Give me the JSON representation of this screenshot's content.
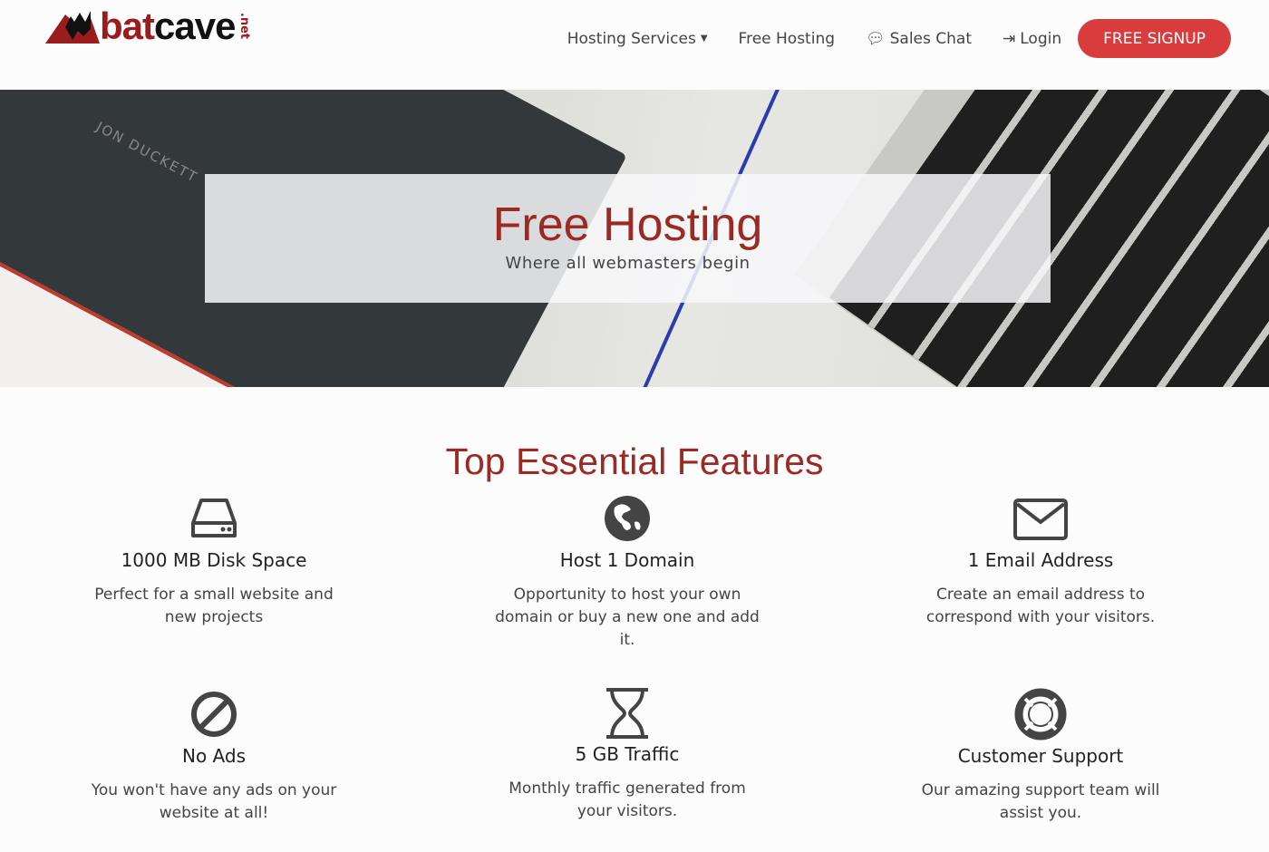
{
  "brand": {
    "name_part1": "bat",
    "name_part2": "cave",
    "tld": ".net",
    "accent": "#9b1c1c"
  },
  "nav": {
    "hosting_services": "Hosting Services",
    "free_hosting": "Free Hosting",
    "sales_chat": "Sales Chat",
    "login": "Login",
    "signup": "FREE SIGNUP",
    "signup_color": "#d93c3d"
  },
  "hero": {
    "title": "Free Hosting",
    "subtitle": "Where all webmasters begin",
    "notebook_text": "JON DUCKETT"
  },
  "features": {
    "title": "Top Essential Features",
    "items": [
      {
        "icon": "hard-drive-icon",
        "title": "1000 MB Disk Space",
        "text": "Perfect for a small website and new projects"
      },
      {
        "icon": "globe-icon",
        "title": "Host 1 Domain",
        "text": "Opportunity to host your own domain or buy a new one and add it."
      },
      {
        "icon": "envelope-icon",
        "title": "1 Email Address",
        "text": "Create an email address to correspond with your visitors."
      },
      {
        "icon": "ban-icon",
        "title": "No Ads",
        "text": "You won't have any ads on your website at all!"
      },
      {
        "icon": "hourglass-icon",
        "title": "5 GB Traffic",
        "text": "Monthly traffic generated from your visitors."
      },
      {
        "icon": "life-ring-icon",
        "title": "Customer Support",
        "text": "Our amazing support team will assist you."
      }
    ]
  }
}
